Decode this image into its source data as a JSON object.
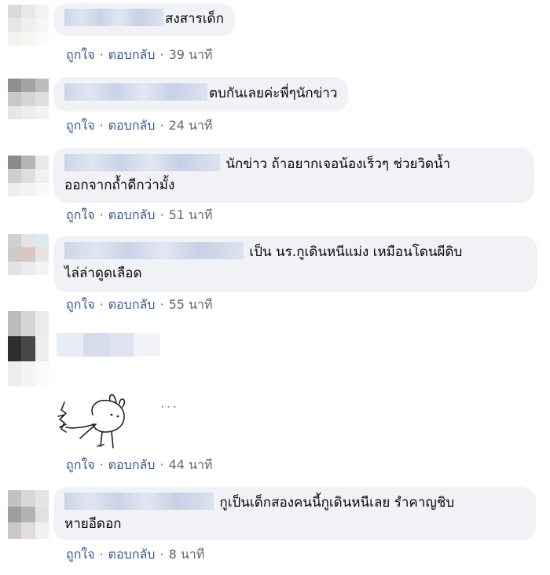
{
  "comments": [
    {
      "text": "สงสารเด็ก",
      "like": "ถูกใจ",
      "reply": "ตอบกลับ",
      "time": "39 นาที"
    },
    {
      "text": "ตบกันเลยค่ะพี่ๆนักข่าว",
      "like": "ถูกใจ",
      "reply": "ตอบกลับ",
      "time": "24 นาที"
    },
    {
      "text_line1": "นักข่าว ถ้าอยากเจอน้องเร็วๆ ช่วยวิดน้ำ",
      "text_line2": "ออกจากถ้ำดีกว่ามั้ง",
      "like": "ถูกใจ",
      "reply": "ตอบกลับ",
      "time": "51 นาที"
    },
    {
      "text_line1": "เป็น นร.กูเดินหนีแม่ง เหมือนโดนผีดิบ",
      "text_line2": "ไล่ล่าดูดเลือด",
      "like": "ถูกใจ",
      "reply": "ตอบกลับ",
      "time": "55 นาที"
    },
    {
      "sticker_icon": "cartoon-rabbit-sticker-icon",
      "more": "···",
      "like": "ถูกใจ",
      "reply": "ตอบกลับ",
      "time": "44 นาที"
    },
    {
      "text_line1": "กูเป็นเด็กสองคนนี้กูเดินหนีเลย รำคาญชิบ",
      "text_line2": "หายอีดอก",
      "like": "ถูกใจ",
      "reply": "ตอบกลับ",
      "time": "8 นาที"
    }
  ],
  "separator": "·",
  "colors": {
    "link": "#385898",
    "meta": "#65676b",
    "bubble": "#f0f2f5",
    "text": "#050505"
  }
}
